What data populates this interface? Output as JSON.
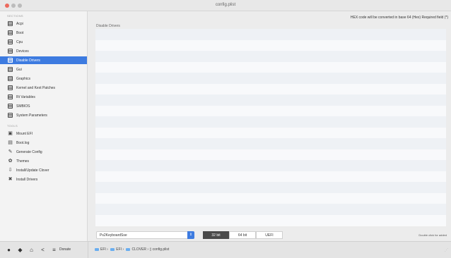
{
  "window": {
    "title": "config.plist"
  },
  "sidebar": {
    "sections_label": "SECTIONS",
    "sections": [
      {
        "label": "Acpi",
        "icon": "list-icon"
      },
      {
        "label": "Boot",
        "icon": "list-icon"
      },
      {
        "label": "Cpu",
        "icon": "list-icon"
      },
      {
        "label": "Devices",
        "icon": "list-icon"
      },
      {
        "label": "Disable Drivers",
        "icon": "list-icon",
        "selected": true
      },
      {
        "label": "Gui",
        "icon": "list-icon"
      },
      {
        "label": "Graphics",
        "icon": "list-icon"
      },
      {
        "label": "Kernel and Kext Patches",
        "icon": "list-icon"
      },
      {
        "label": "Rt Variables",
        "icon": "list-icon"
      },
      {
        "label": "SMBIOS",
        "icon": "list-icon"
      },
      {
        "label": "System Parameters",
        "icon": "list-icon"
      }
    ],
    "tools_label": "TOOLS",
    "tools": [
      {
        "label": "Mount EFI",
        "icon": "disk-icon"
      },
      {
        "label": "Boot.log",
        "icon": "document-icon"
      },
      {
        "label": "Generate Config",
        "icon": "wrench-icon"
      },
      {
        "label": "Themes",
        "icon": "flower-icon"
      },
      {
        "label": "Install/Update Clover",
        "icon": "install-icon"
      },
      {
        "label": "Install Drivers",
        "icon": "tools-icon"
      }
    ]
  },
  "main": {
    "hex_note": "HEX code will be converted in base 64 (Hex)   Required field (*)",
    "table_header": "Disable Drivers",
    "driver_select": "Ps2KeyboardSse",
    "segments": [
      "32 bit",
      "64 bit",
      "UEFI"
    ],
    "active_segment": "32 bit",
    "double_click_note": "Double click for added"
  },
  "bottom_bar": {
    "donate_label": "Donate",
    "path": [
      "EFI",
      "EFI",
      "CLOVER",
      "config.plist"
    ]
  }
}
